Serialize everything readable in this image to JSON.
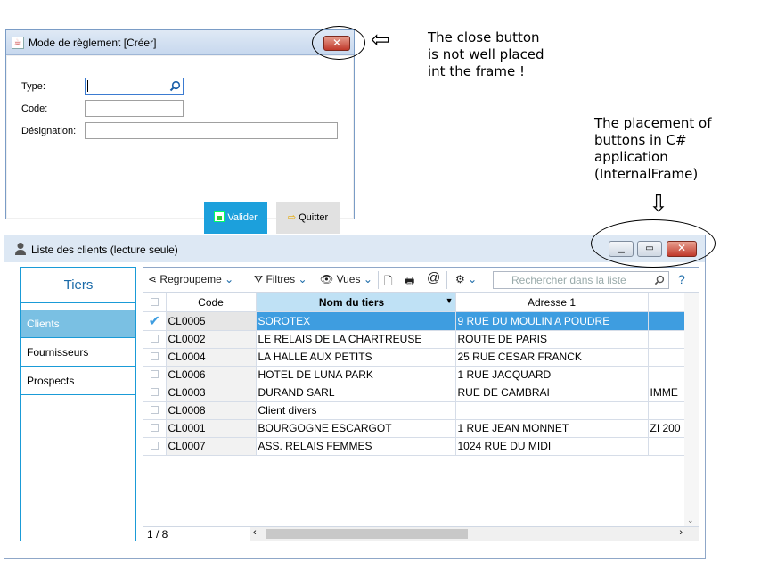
{
  "dialog": {
    "title": "Mode de règlement [Créer]",
    "close_glyph": "✕",
    "fields": [
      {
        "label": "Type:",
        "value": ""
      },
      {
        "label": "Code:",
        "value": ""
      },
      {
        "label": "Désignation:",
        "value": ""
      }
    ],
    "valider_label": "Valider",
    "quitter_label": "Quitter"
  },
  "annotations": {
    "note1": [
      "The close button",
      "is not well placed",
      "int the frame !"
    ],
    "note2": [
      "The placement of",
      "buttons in C#",
      "application",
      "(InternalFrame)"
    ],
    "left_arrow": "⇦",
    "down_arrow": "⇩"
  },
  "window": {
    "title": "Liste des clients (lecture seule)",
    "sidebar": {
      "title": "Tiers",
      "items": [
        "Clients",
        "Fournisseurs",
        "Prospects"
      ],
      "active_index": 0
    },
    "toolbar": {
      "group_label": "Regroupeme",
      "filter_label": "Filtres",
      "views_label": "Vues",
      "search_placeholder": "Rechercher dans la liste",
      "help": "?"
    },
    "columns": [
      "Code",
      "Nom du tiers",
      "Adresse 1",
      ""
    ],
    "rows": [
      {
        "code": "CL0005",
        "nom": "SOROTEX",
        "adresse": "9 RUE DU MOULIN A POUDRE",
        "extra": "",
        "selected": true
      },
      {
        "code": "CL0002",
        "nom": "LE RELAIS DE LA CHARTREUSE",
        "adresse": "ROUTE DE PARIS",
        "extra": ""
      },
      {
        "code": "CL0004",
        "nom": "LA HALLE AUX PETITS",
        "adresse": "25 RUE CESAR FRANCK",
        "extra": ""
      },
      {
        "code": "CL0006",
        "nom": "HOTEL DE LUNA PARK",
        "adresse": "1 RUE JACQUARD",
        "extra": ""
      },
      {
        "code": "CL0003",
        "nom": "DURAND SARL",
        "adresse": "RUE DE CAMBRAI",
        "extra": "IMME"
      },
      {
        "code": "CL0008",
        "nom": "Client divers",
        "adresse": "",
        "extra": ""
      },
      {
        "code": "CL0001",
        "nom": "BOURGOGNE ESCARGOT",
        "adresse": "1 RUE JEAN MONNET",
        "extra": "ZI 200"
      },
      {
        "code": "CL0007",
        "nom": "ASS. RELAIS FEMMES",
        "adresse": "1024 RUE DU MIDI",
        "extra": ""
      }
    ],
    "record_count": "1 / 8"
  },
  "colors": {
    "accent": "#1ca0dc",
    "selected_row": "#3e9de0",
    "close_red": "#c0392b"
  }
}
